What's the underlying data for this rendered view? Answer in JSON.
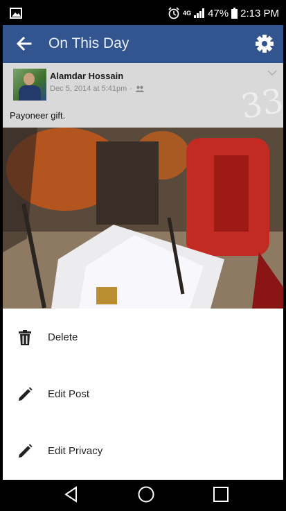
{
  "status_bar": {
    "network": "4G",
    "battery": "47%",
    "time": "2:13 PM"
  },
  "toolbar": {
    "title": "On This Day"
  },
  "post": {
    "author": "Alamdar Hossain",
    "date": "Dec 5, 2014 at 5:41pm",
    "separator": "·",
    "text": "Payoneer gift."
  },
  "watermark": {
    "text": "33"
  },
  "menu": [
    {
      "label": "Delete",
      "icon": "trash-icon"
    },
    {
      "label": "Edit Post",
      "icon": "pencil-icon"
    },
    {
      "label": "Edit Privacy",
      "icon": "pencil-icon"
    }
  ],
  "colors": {
    "toolbar": "#33558f",
    "post_bg": "#d9d9d9",
    "menu_bg": "#ffffff"
  }
}
